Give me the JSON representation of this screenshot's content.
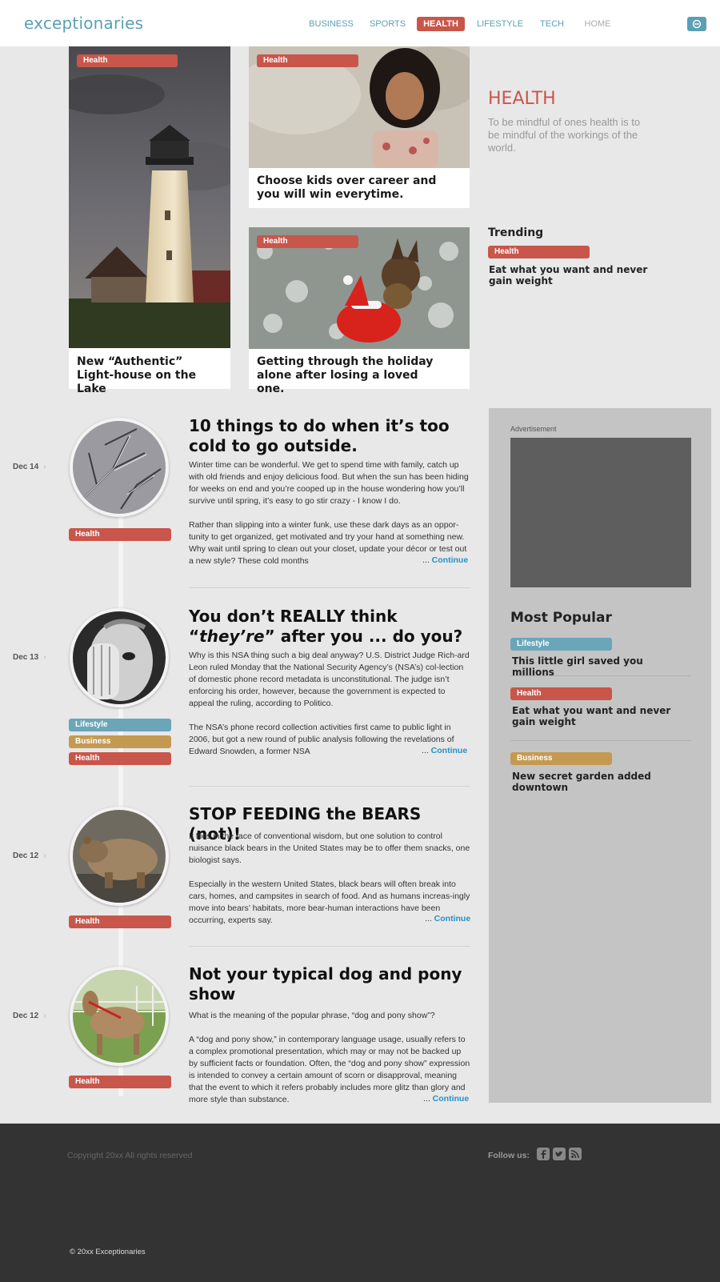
{
  "brand": {
    "logo": "exceptionaries"
  },
  "nav": {
    "items": [
      "BUSINESS",
      "SPORTS",
      "HEALTH",
      "LIFESTYLE",
      "TECH",
      "HOME"
    ],
    "active": "HEALTH"
  },
  "colors": {
    "accent": "#5aa0b4",
    "health": "#c8564b",
    "lifestyle": "#6aa6b8",
    "business": "#c49a52",
    "link": "#2a8fc4",
    "footer": "#333333"
  },
  "features": {
    "lighthouse": {
      "tag": "Health",
      "title": "New “Authentic” Light-house on the Lake"
    },
    "kids": {
      "tag": "Health",
      "title": "Choose kids over career and you will win everytime."
    },
    "holiday": {
      "tag": "Health",
      "title": "Getting through the holiday alone after losing a loved one."
    }
  },
  "section": {
    "title": "HEALTH",
    "description": "To be mindful of ones health is to be mindful of the workings of the world."
  },
  "trending": {
    "heading": "Trending",
    "tag": "Health",
    "title": "Eat what you want and never gain weight"
  },
  "posts": [
    {
      "date": "Dec 14",
      "tags": [
        "Health"
      ],
      "title": "10 things to do when it’s too cold to go outside.",
      "p1": "Winter time can be wonderful. We get to spend time with family, catch up with old friends and enjoy delicious food. But when the sun has been hiding for weeks on end and you’re cooped up in the house wondering how you’ll survive until spring, it’s easy to go stir crazy - I know I do.",
      "p2": "Rather than slipping into a winter funk, use these dark days as an oppor-tunity to get organized, get motivated and try your hand at something new. Why wait until spring to clean out your closet, update your décor or test out a new style? These cold months",
      "more_prefix": "... ",
      "more_label": "Continue"
    },
    {
      "date": "Dec 13",
      "tags": [
        "Lifestyle",
        "Business",
        "Health"
      ],
      "title_pre": "You don’t REALLY think “",
      "title_em": "they’re",
      "title_post": "” after you ... do you?",
      "p1": "Why is this NSA thing such a big deal anyway? U.S. District Judge Rich-ard Leon ruled Monday that the National Security Agency’s (NSA’s) col-lection of domestic phone record metadata is unconstitutional. The judge isn’t enforcing his order, however, because the government is expected to appeal the ruling, according to Politico.",
      "p2": "The NSA’s phone record collection activities first came to public light in 2006, but got a new round of public analysis following the revelations of Edward Snowden, a former NSA",
      "more_prefix": "... ",
      "more_label": "Continue"
    },
    {
      "date": "Dec 12",
      "tags": [
        "Health"
      ],
      "title": "STOP FEEDING the BEARS (not)!",
      "p1": "It flies in the face of conventional wisdom, but one solution to control nuisance black bears in the United States may be to offer them snacks, one biologist says.",
      "p2": "Especially in the western United States, black bears will often break into cars, homes, and campsites in search of food. And as humans increas-ingly move into bears’ habitats, more bear-human interactions have been occurring, experts say.",
      "more_prefix": "... ",
      "more_label": "Continue"
    },
    {
      "date": "Dec 12",
      "tags": [
        "Health"
      ],
      "title": "Not your typical dog and pony show",
      "p1": "What is the meaning of the popular phrase, “dog and pony show”?",
      "p2": "A “dog and pony show,” in contemporary language usage, usually refers to a complex promotional presentation, which may or may not be backed up by sufficient facts or foundation. Often, the “dog and pony show” expression is intended to convey a certain amount of scorn or disapproval, meaning that the event to which it refers probably includes more glitz than glory and more style than substance.",
      "more_prefix": "... ",
      "more_label": "Continue"
    }
  ],
  "sidebar": {
    "ad_label": "Advertisement",
    "popular_heading": "Most Popular",
    "popular": [
      {
        "tag": "Lifestyle",
        "title": "This little girl saved you millions"
      },
      {
        "tag": "Health",
        "title": "Eat what you want and never gain weight"
      },
      {
        "tag": "Business",
        "title": "New secret garden added downtown"
      }
    ]
  },
  "footer": {
    "copyright": "Copyright 20xx All rights reserved",
    "follow_label": "Follow us:",
    "social_icons": [
      "facebook-icon",
      "twitter-icon",
      "rss-icon"
    ],
    "bottom": "© 20xx Exceptionaries"
  }
}
